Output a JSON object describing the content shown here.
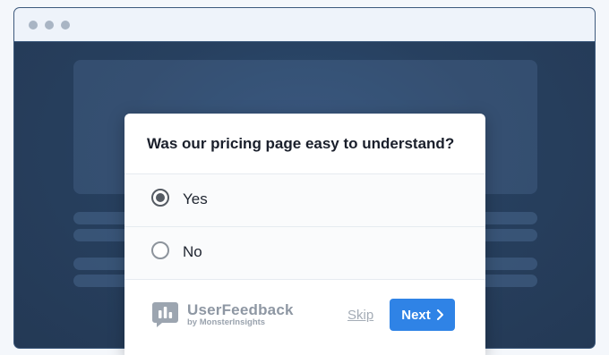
{
  "survey": {
    "question": "Was our pricing page easy to understand?",
    "options": [
      {
        "label": "Yes",
        "selected": true
      },
      {
        "label": "No",
        "selected": false
      }
    ]
  },
  "footer": {
    "brand_name": "UserFeedback",
    "brand_sub": "by MonsterInsights",
    "skip_label": "Skip",
    "next_label": "Next",
    "next_icon": "chevron-right-icon",
    "logo_icon": "userfeedback-logo-icon"
  },
  "colors": {
    "accent": "#2f83e6",
    "window_bg": "#273b59",
    "titlebar_bg": "#eef3fa"
  }
}
